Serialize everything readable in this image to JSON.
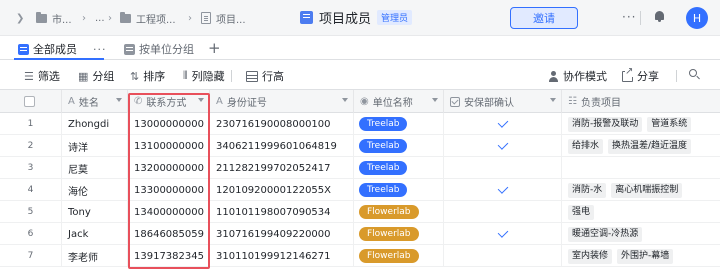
{
  "topbar": {
    "breadcrumb": [
      {
        "icon": "folder-icon",
        "label": "市..."
      },
      {
        "label": "..."
      },
      {
        "icon": "folder-icon",
        "label": "工程项..."
      },
      {
        "icon": "document-icon",
        "label": "项目..."
      }
    ],
    "title": "项目成员",
    "role_badge": "管理员",
    "invite_label": "邀请",
    "avatar_initial": "H"
  },
  "tabs": {
    "items": [
      {
        "label": "全部成员",
        "active": true
      },
      {
        "label": "按单位分组",
        "active": false
      }
    ]
  },
  "toolbar": {
    "filter": "筛选",
    "group": "分组",
    "sort": "排序",
    "hide_columns": "列隐藏",
    "row_height": "行高",
    "collab_mode": "协作模式",
    "share": "分享"
  },
  "table": {
    "columns": [
      {
        "label": "姓名",
        "icon": "A"
      },
      {
        "label": "联系方式",
        "icon": "phone-icon"
      },
      {
        "label": "身份证号",
        "icon": "A"
      },
      {
        "label": "单位名称",
        "icon": "select-icon"
      },
      {
        "label": "安保部确认",
        "icon": "checkbox-icon"
      },
      {
        "label": "负责项目",
        "icon": "multiselect-icon"
      }
    ],
    "rows": [
      {
        "index": "1",
        "name": "Zhongdi",
        "phone": "13000000000",
        "id": "230716190008000100",
        "unit": "Treelab",
        "confirmed": true,
        "projects": [
          "消防-报警及联动",
          "管道系统"
        ]
      },
      {
        "index": "2",
        "name": "诗洋",
        "phone": "13100000000",
        "id": "340621199960106481​9",
        "unit": "Treelab",
        "confirmed": true,
        "projects": [
          "给排水",
          "换热温差/趋近温度"
        ]
      },
      {
        "index": "3",
        "name": "尼莫",
        "phone": "13200000000",
        "id": "211282199702052417",
        "unit": "Treelab",
        "confirmed": false,
        "projects": []
      },
      {
        "index": "4",
        "name": "海伦",
        "phone": "13300000000",
        "id": "12010920000122055X",
        "unit": "Treelab",
        "confirmed": true,
        "projects": [
          "消防-水",
          "离心机喘振控制"
        ]
      },
      {
        "index": "5",
        "name": "Tony",
        "phone": "13400000000",
        "id": "110101198007090534",
        "unit": "Flowerlab",
        "confirmed": false,
        "projects": [
          "强电"
        ]
      },
      {
        "index": "6",
        "name": "Jack",
        "phone": "18646085059",
        "id": "310716199409220000",
        "unit": "Flowerlab",
        "confirmed": true,
        "projects": [
          "暖通空调-冷热源"
        ]
      },
      {
        "index": "7",
        "name": "李老师",
        "phone": "13917382345",
        "id": "310110199912146271",
        "unit": "Flowerlab",
        "confirmed": false,
        "projects": [
          "室内装修",
          "外围护-幕墙"
        ]
      }
    ]
  },
  "colors": {
    "accent": "#3370ff",
    "treelab": "#3370ff",
    "flowerlab": "#d99a2b",
    "highlight": "#e8505b"
  }
}
